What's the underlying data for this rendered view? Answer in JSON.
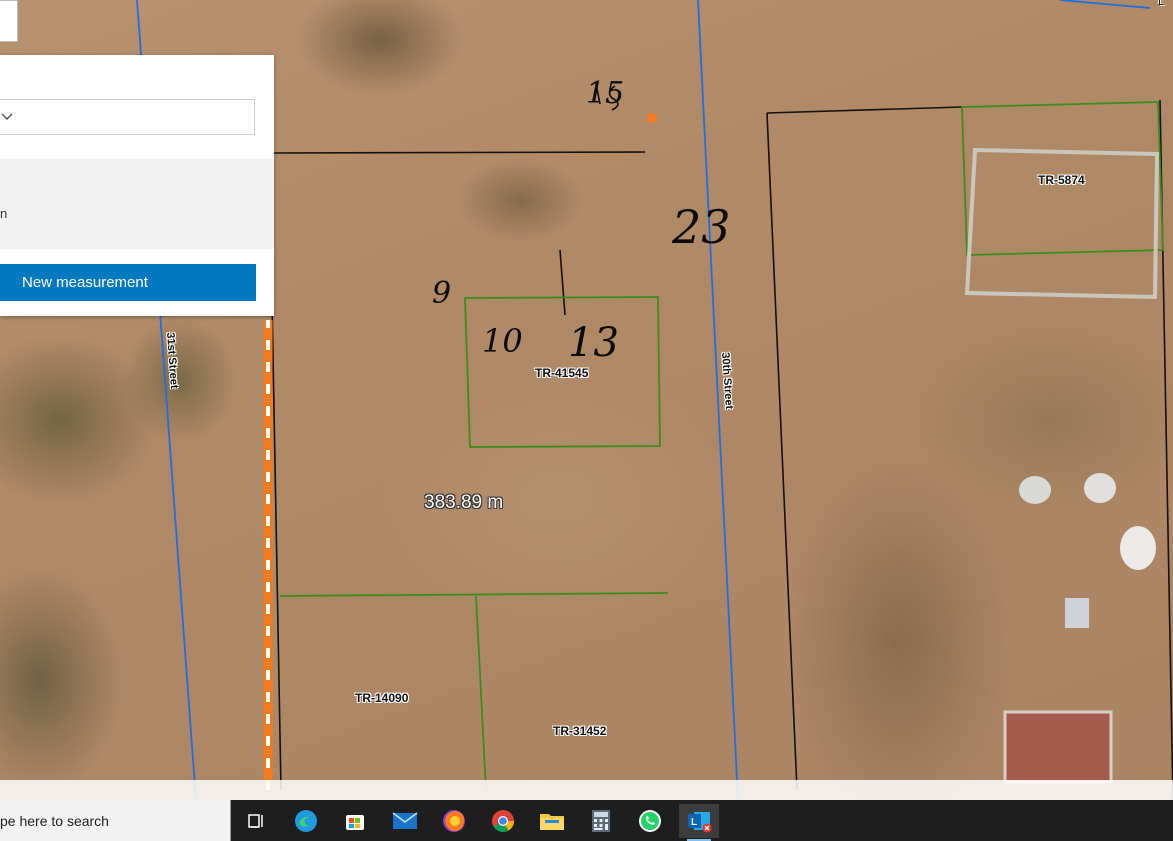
{
  "map": {
    "parcels": [
      {
        "id": "tr-5874",
        "label": "TR-5874"
      },
      {
        "id": "tr-41545",
        "label": "TR-41545"
      },
      {
        "id": "tr-14090",
        "label": "TR-14090"
      },
      {
        "id": "tr-31452",
        "label": "TR-31452"
      }
    ],
    "streets": [
      {
        "id": "31st",
        "label": "31st Street"
      },
      {
        "id": "30th",
        "label": "30th Street"
      }
    ],
    "corner_label": "L",
    "measurement_label": "383.89 m",
    "handwritten": {
      "top": "15",
      "right": "23",
      "left": "9",
      "bottom_left": "10",
      "bottom_right": "13"
    },
    "colors": {
      "measurement_line": "#f47b20",
      "parcel_boundary": "#3c8c1e",
      "street_line": "#1f6fe0",
      "property_line": "#111111"
    }
  },
  "measure_panel": {
    "unit_value": "",
    "result_text": "n",
    "new_measurement_label": "New measurement"
  },
  "taskbar": {
    "search_placeholder": "pe here to search",
    "apps": [
      "task-view",
      "edge",
      "store",
      "mail",
      "firefox",
      "chrome",
      "file-explorer",
      "calculator",
      "whatsapp",
      "outlook"
    ]
  }
}
